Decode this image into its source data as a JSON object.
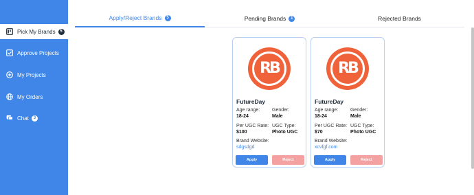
{
  "sidebar": {
    "items": [
      {
        "label": "Pick My Brands",
        "badge": "5",
        "icon": "board-icon",
        "active": true
      },
      {
        "label": "Approve Projects",
        "badge": "",
        "icon": "checkbox-icon"
      },
      {
        "label": "My Projects",
        "badge": "",
        "icon": "circle-plus-icon"
      },
      {
        "label": "My Orders",
        "badge": "",
        "icon": "globe-icon"
      },
      {
        "label": "Chat",
        "badge": "3",
        "icon": "chat-icon"
      }
    ]
  },
  "tabs": [
    {
      "label": "Apply/Reject Brands",
      "badge": "5",
      "active": true
    },
    {
      "label": "Pending Brands",
      "badge": "1"
    },
    {
      "label": "Rejected Brands",
      "badge": ""
    }
  ],
  "cards": [
    {
      "logo_text": "RB",
      "name": "FutureDay",
      "age_label": "Age range:",
      "age": "18-24",
      "gender_label": "Gender:",
      "gender": "Male",
      "rate_label": "Per UGC Rate:",
      "rate": "$100",
      "type_label": "UGC Type:",
      "type": "Photo UGC",
      "website_label": "Brand Website:",
      "website": "sdgsdgd",
      "apply": "Apply",
      "reject": "Reject"
    },
    {
      "logo_text": "RB",
      "name": "FutureDay",
      "age_label": "Age range:",
      "age": "18-24",
      "gender_label": "Gender:",
      "gender": "Male",
      "rate_label": "Per UGC Rate:",
      "rate": "$70",
      "type_label": "UGC Type:",
      "type": "Photo UGC",
      "website_label": "Brand Website:",
      "website": "xcvfgf.com",
      "apply": "Apply",
      "reject": "Reject"
    }
  ],
  "colors": {
    "sidebar": "#3f86e8",
    "accent": "#3f86e8",
    "logo": "#f0623a",
    "reject": "#f4a1a1"
  }
}
